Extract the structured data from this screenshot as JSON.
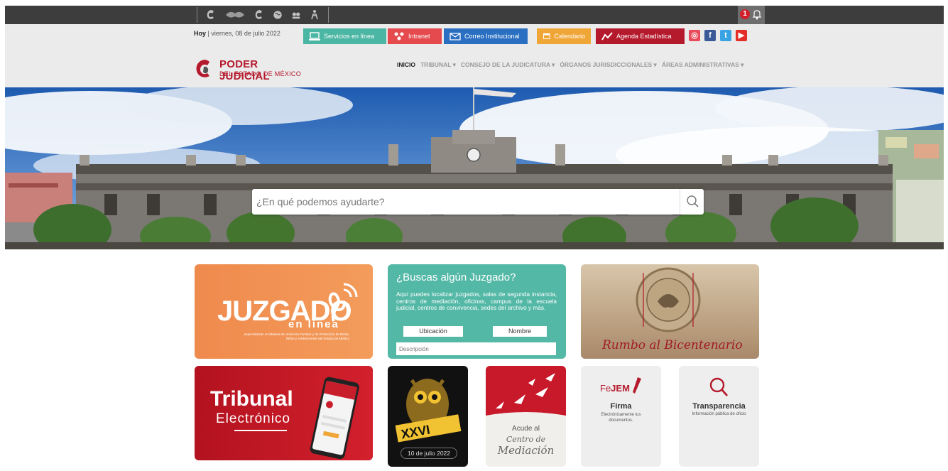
{
  "topbar": {
    "notifications_count": "1",
    "icons": [
      "poder-judicial-icon",
      "escudo-icon",
      "poder-judicial-icon",
      "globe-icon",
      "conference-icon",
      "accessibility-icon"
    ]
  },
  "header": {
    "date_prefix": "Hoy",
    "date_text": " | viernes, 08 de julio 2022",
    "quick_links": [
      {
        "label": "Servicios en línea",
        "color": "#4bb6a3"
      },
      {
        "label": "Intranet",
        "color": "#e54a4e"
      },
      {
        "label": "Correo Institucional",
        "color": "#2a6fc2"
      },
      {
        "label": "Calendario",
        "color": "#f0a637"
      },
      {
        "label": "Agenda Estadística",
        "color": "#b5192c"
      }
    ],
    "logo_line1": "PODER JUDICIAL",
    "logo_line2": "DEL ESTADO DE MÉXICO",
    "nav": [
      "INICIO",
      "TRIBUNAL ▾",
      "CONSEJO DE LA JUDICATURA ▾",
      "ÓRGANOS JURISDICCIONALES ▾",
      "ÁREAS ADMINISTRATIVAS ▾"
    ]
  },
  "hero": {
    "search_placeholder": "¿En qué podemos ayudarte?"
  },
  "cards": {
    "juzgado": {
      "main": "JUZGADO",
      "sub": "en línea",
      "small": "especializado en Materia de Violencia Familiar y de Protección de Niñas, Niños y Adolescentes del Estado de México"
    },
    "busca": {
      "title": "¿Buscas algún Juzgado?",
      "text": "Aquí puedes localizar juzgados, salas de segunda instancia, centros de mediación, oficinas, campus de la escuela judicial, centros de convivencia, sedes del archivo y más.",
      "btn_ubicacion": "Ubicación",
      "btn_nombre": "Nombre",
      "input_placeholder": "Descripción"
    },
    "bicentenario": {
      "text": "Rumbo al Bicentenario"
    },
    "tribunal": {
      "main": "Tribunal",
      "sub": "Electrónico"
    },
    "xxvi": {
      "date": "10 de julio 2022"
    },
    "mediacion": {
      "line1": "Acude al",
      "line2": "Centro de",
      "line3": "Mediación"
    },
    "fejem": {
      "logo_a": "Fe",
      "logo_b": "JEM",
      "title": "Firma",
      "desc": "Electrónicamente tus documentos."
    },
    "transparencia": {
      "title": "Transparencia",
      "desc": "Información pública de oficio"
    }
  }
}
